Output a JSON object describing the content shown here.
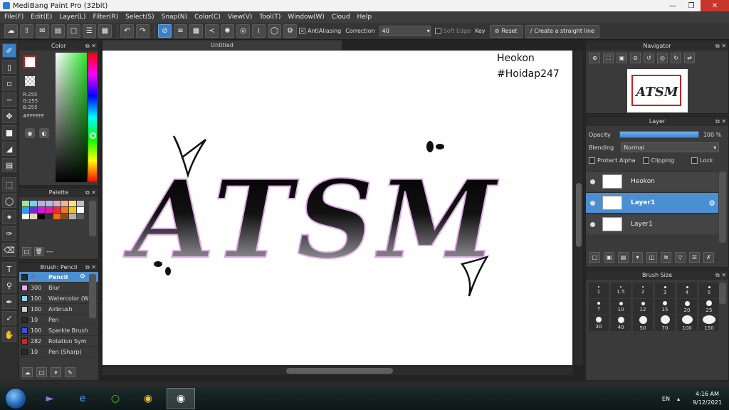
{
  "window": {
    "title": "MediBang Paint Pro (32bit)"
  },
  "menu": [
    "File(F)",
    "Edit(E)",
    "Layer(L)",
    "Filter(R)",
    "Select(S)",
    "Snap(N)",
    "Color(C)",
    "View(V)",
    "Tool(T)",
    "Window(W)",
    "Cloud",
    "Help"
  ],
  "toolbar": {
    "antialiasing_label": "AntiAliasing",
    "correction_label": "Correction",
    "correction_value": "40",
    "soft_edge_label": "Soft Edge",
    "key_label": "Key",
    "reset_label": "Reset",
    "straight_line_label": "Create a straight line"
  },
  "color_panel": {
    "title": "Color",
    "r": "R:255",
    "g": "G:255",
    "b": "B:255",
    "hex": "#FFFFFF"
  },
  "palette_panel": {
    "title": "Palette",
    "count_text": "---",
    "colors": [
      "#9be89b",
      "#74d2f2",
      "#c8a8e8",
      "#b8b8f0",
      "#f2a4c8",
      "#ffb27a",
      "#ffe36a",
      "#c0c0c0",
      "#2ea0e6",
      "#6a30d0",
      "#d018d8",
      "#e818a0",
      "#e83030",
      "#f07818",
      "#e8c818",
      "#ffffff",
      "#ffffff",
      "#e8d8b0",
      "#000000",
      "#303030",
      "#ff6a00",
      "#8a4a20",
      "#b0b0b0",
      "#606060"
    ]
  },
  "brush_panel": {
    "title": "Brush: Pencil",
    "items": [
      {
        "size": "4",
        "name": "Pencil",
        "color": "#2a2a2a"
      },
      {
        "size": "300",
        "name": "Blur",
        "color": "#f2a8e8"
      },
      {
        "size": "100",
        "name": "Watercolor (W",
        "color": "#8ad6f2"
      },
      {
        "size": "100",
        "name": "Airbrush",
        "color": "#cfcfcf"
      },
      {
        "size": "10",
        "name": "Pen",
        "color": "#2a2a2a"
      },
      {
        "size": "100",
        "name": "Sparkle Brush",
        "color": "#3a4fe0"
      },
      {
        "size": "282",
        "name": "Rotation Sym",
        "color": "#e02020"
      },
      {
        "size": "10",
        "name": "Pen (Sharp)",
        "color": "#2a2a2a"
      }
    ]
  },
  "canvas": {
    "tab_title": "Untitled",
    "artwork_text": "ATSM",
    "watermark_line1": "Heokon",
    "watermark_line2": "#Hoidap247"
  },
  "navigator": {
    "title": "Navigator"
  },
  "layer_panel": {
    "title": "Layer",
    "opacity_label": "Opacity",
    "opacity_value": "100 %",
    "opacity_fraction": 1.0,
    "blending_label": "Blending",
    "blending_value": "Normal",
    "protect_alpha_label": "Protect Alpha",
    "clipping_label": "Clipping",
    "lock_label": "Lock",
    "layers": [
      {
        "name": "Heokon",
        "selected": false
      },
      {
        "name": "Layer1",
        "selected": true
      },
      {
        "name": "Layer1",
        "selected": false
      }
    ]
  },
  "brush_size_panel": {
    "title": "Brush Size",
    "sizes": [
      "1",
      "1.5",
      "2",
      "3",
      "4",
      "5",
      "7",
      "10",
      "12",
      "15",
      "20",
      "25",
      "30",
      "40",
      "50",
      "70",
      "100",
      "150"
    ]
  },
  "taskbar": {
    "lang": "EN",
    "time": "4:16 AM",
    "date": "9/12/2021"
  }
}
